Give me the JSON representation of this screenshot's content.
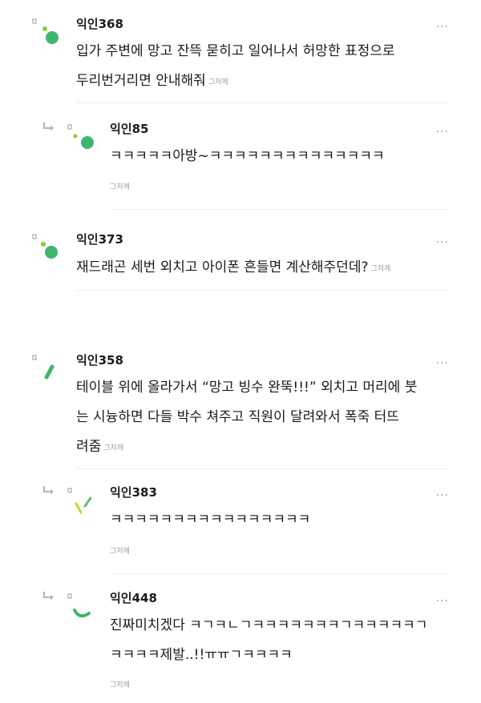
{
  "time_label": "그저께",
  "more_label": "···",
  "comments": [
    {
      "nick": "익인368",
      "lines": [
        "입가 주변에 망고 잔뜩 묻히고 일어나서 허망한 표정으로",
        "두리번거리면 안내해줘"
      ],
      "avatar": "dot-circle-avatar-icon"
    },
    {
      "nick": "익인85",
      "lines": [
        "ㅋㅋㅋㅋㅋ아방~ㅋㅋㅋㅋㅋㅋㅋㅋㅋㅋㅋㅋㅋㅋ"
      ],
      "avatar": "dot-circle-avatar-icon",
      "reply": true
    },
    {
      "nick": "익인373",
      "lines": [
        "재드래곤 세번 외치고 아이폰 흔들면 계산해주던데?"
      ],
      "avatar": "dot-circle-avatar-icon"
    },
    {
      "nick": "익인358",
      "lines": [
        "테이블 위에 올라가서 “망고 빙수 완뚝!!!” 외치고 머리에 붓",
        "는 시늉하면 다들 박수 쳐주고 직원이 달려와서 폭죽 터뜨",
        "려줌"
      ],
      "avatar": "slash-avatar-icon"
    },
    {
      "nick": "익인383",
      "lines": [
        "ㅋㅋㅋㅋㅋㅋㅋㅋㅋㅋㅋㅋㅋㅋㅋㅋ"
      ],
      "avatar": "v-avatar-icon",
      "reply": true
    },
    {
      "nick": "익인448",
      "lines": [
        "진짜미치겠다 ㅋㄱㅋㄴㄱㅋㅋㅋㅋㅋㅋㅋㄱㅋㅋㅋㅋㅋㄱ",
        "ㅋㅋㅋㅋ제발..!!ㅠㅠㄱㅋㅋㅋㅋ"
      ],
      "avatar": "arc-avatar-icon",
      "reply": true
    }
  ]
}
